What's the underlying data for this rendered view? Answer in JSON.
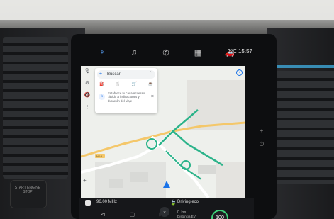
{
  "status_bar": {
    "temperature": "7ºC",
    "time": "15:57",
    "apps": [
      {
        "icon": "navigation-pin-icon",
        "active": true
      },
      {
        "icon": "music-icon",
        "active": false
      },
      {
        "icon": "phone-icon",
        "active": false
      },
      {
        "icon": "apps-grid-icon",
        "active": false
      },
      {
        "icon": "car-icon",
        "active": false
      }
    ]
  },
  "map_panel": {
    "search": {
      "label": "Buscar",
      "categories": [
        "gas-station-icon",
        "restaurant-icon",
        "grocery-icon",
        "cafe-icon"
      ]
    },
    "promo": {
      "text": "Establece tu casa Accesso rápido a indicaciones y duración del viaje"
    },
    "side_tools": [
      "mic-icon",
      "settings-icon",
      "mute-icon",
      "more-icon"
    ],
    "zoom": {
      "plus": "+",
      "minus": "−"
    },
    "road_labels": [
      "N-VI"
    ],
    "colors": {
      "route": "#2bb38a",
      "highway": "#f4c76a",
      "map_bg": "#eef0ec"
    }
  },
  "bottom_bar": {
    "radio": "96,00 MHz",
    "driving_mode": "Driving eco",
    "ev_distance": "0. km",
    "ev_label": "Distancia EV",
    "ev_score": "100",
    "accent": "#3ed37a"
  },
  "dashboard": {
    "knob_label": "START ENGINE STOP"
  }
}
